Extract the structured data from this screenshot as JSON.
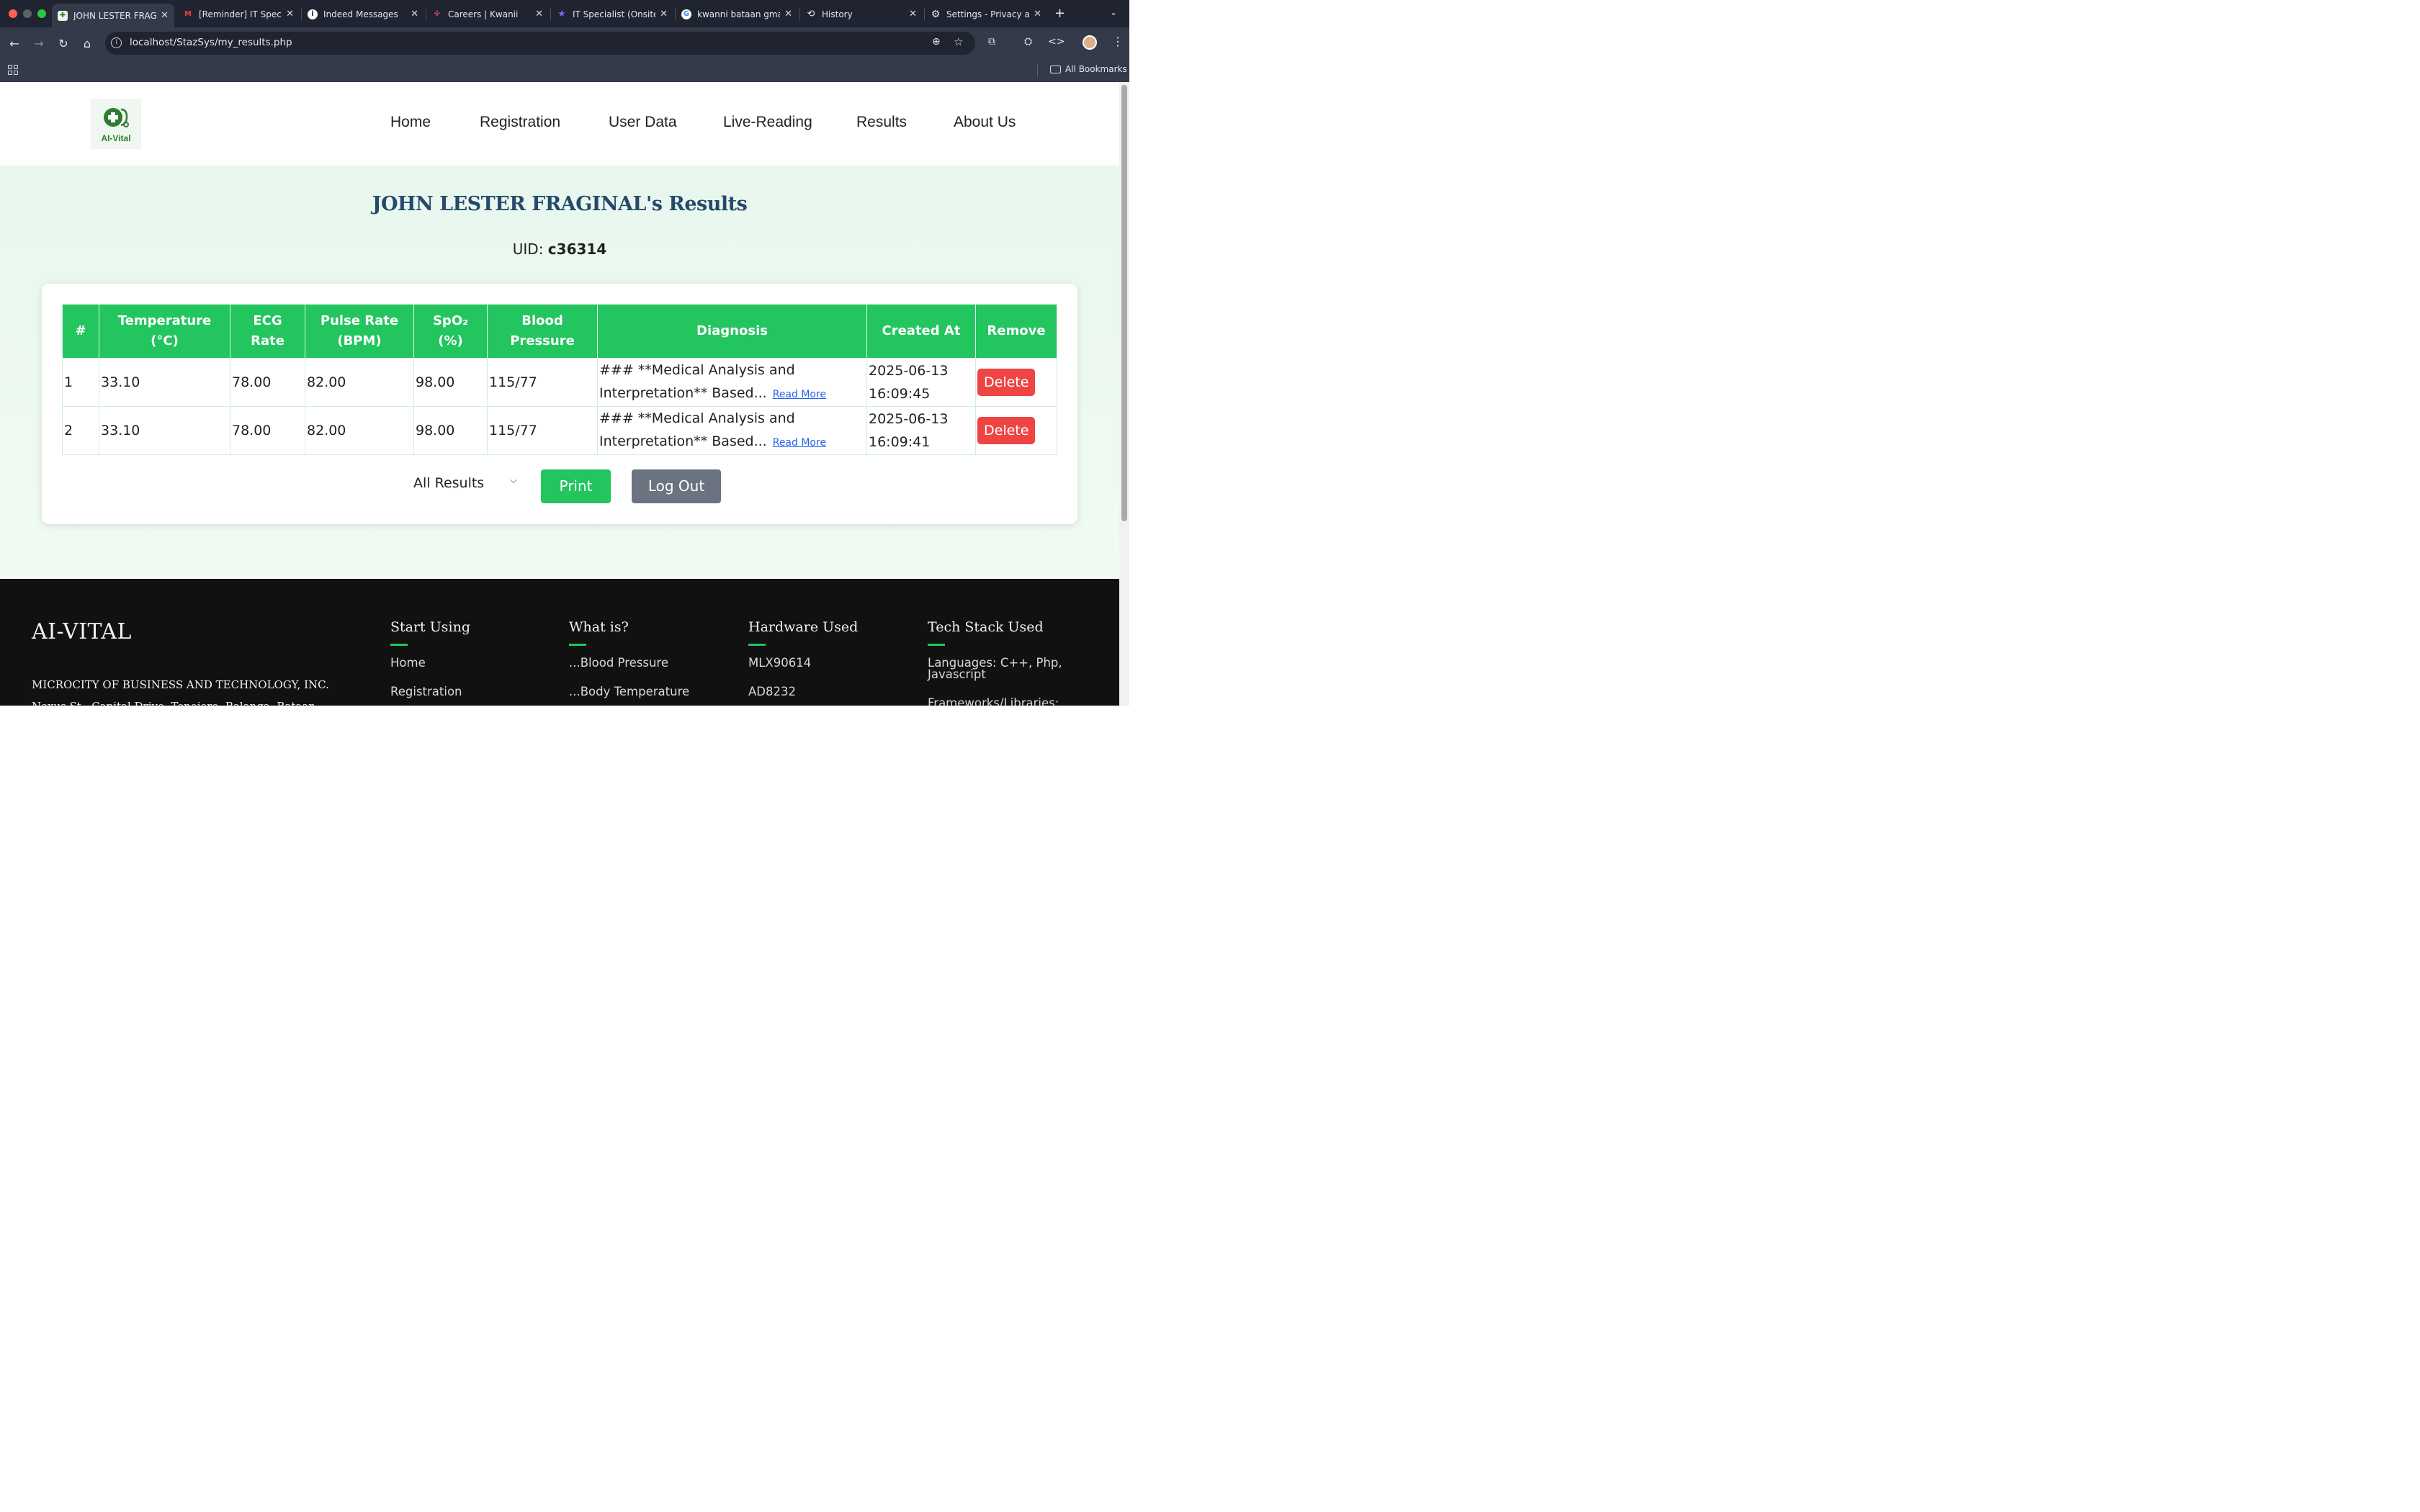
{
  "browser": {
    "tabs": [
      {
        "title": "JOHN LESTER FRAGINAL",
        "active": true,
        "favicon": "aivital-favicon"
      },
      {
        "title": "[Reminder] IT Specialist",
        "favicon": "gmail-icon"
      },
      {
        "title": "Indeed Messages",
        "favicon": "info-icon"
      },
      {
        "title": "Careers | Kwanii",
        "favicon": "kwanii-icon"
      },
      {
        "title": "IT Specialist (Onsite",
        "favicon": "star-icon"
      },
      {
        "title": "kwanni bataan gmaps",
        "favicon": "google-icon"
      },
      {
        "title": "History",
        "favicon": "history-icon"
      },
      {
        "title": "Settings - Privacy and",
        "favicon": "settings-icon"
      }
    ],
    "url": "localhost/StazSys/my_results.php",
    "bookmarks_label": "All Bookmarks"
  },
  "site": {
    "logo_text": "AI-Vital",
    "nav": [
      "Home",
      "Registration",
      "User Data",
      "Live-Reading",
      "Results",
      "About Us"
    ]
  },
  "page": {
    "title": "JOHN LESTER FRAGINAL's Results",
    "uid_label": "UID:",
    "uid_value": "c36314"
  },
  "table": {
    "headers": [
      "#",
      "Temperature (°C)",
      "ECG Rate",
      "Pulse Rate (BPM)",
      "SpO₂ (%)",
      "Blood Pressure",
      "Diagnosis",
      "Created At",
      "Remove"
    ],
    "rows": [
      {
        "num": "1",
        "temperature": "33.10",
        "ecg": "78.00",
        "pulse": "82.00",
        "spo2": "98.00",
        "bp": "115/77",
        "diagnosis": "### **Medical Analysis and Interpretation** Based...",
        "read_more": "Read More",
        "created": "2025-06-13 16:09:45",
        "delete": "Delete"
      },
      {
        "num": "2",
        "temperature": "33.10",
        "ecg": "78.00",
        "pulse": "82.00",
        "spo2": "98.00",
        "bp": "115/77",
        "diagnosis": "### **Medical Analysis and Interpretation** Based...",
        "read_more": "Read More",
        "created": "2025-06-13 16:09:41",
        "delete": "Delete"
      }
    ]
  },
  "controls": {
    "filter_value": "All Results",
    "print_label": "Print",
    "logout_label": "Log Out"
  },
  "footer": {
    "brand": "AI-VITAL",
    "company": "MICROCITY OF BUSINESS AND TECHNOLOGY, INC.",
    "address": "Nexus St., Capital Drive, Tenejero, Balanga, Bataan",
    "columns": [
      {
        "title": "Start Using",
        "items": [
          "Home",
          "Registration"
        ]
      },
      {
        "title": "What is?",
        "items": [
          "...Blood Pressure",
          "...Body Temperature"
        ]
      },
      {
        "title": "Hardware Used",
        "items": [
          "MLX90614",
          "AD8232"
        ]
      },
      {
        "title": "Tech Stack Used",
        "items": [
          "Languages: C++, Php, Javascript",
          "Frameworks/Libraries:"
        ]
      }
    ]
  },
  "colors": {
    "accent": "#22c55e",
    "danger": "#ef4444",
    "title": "#274a6b",
    "footer_bg": "#111111"
  }
}
